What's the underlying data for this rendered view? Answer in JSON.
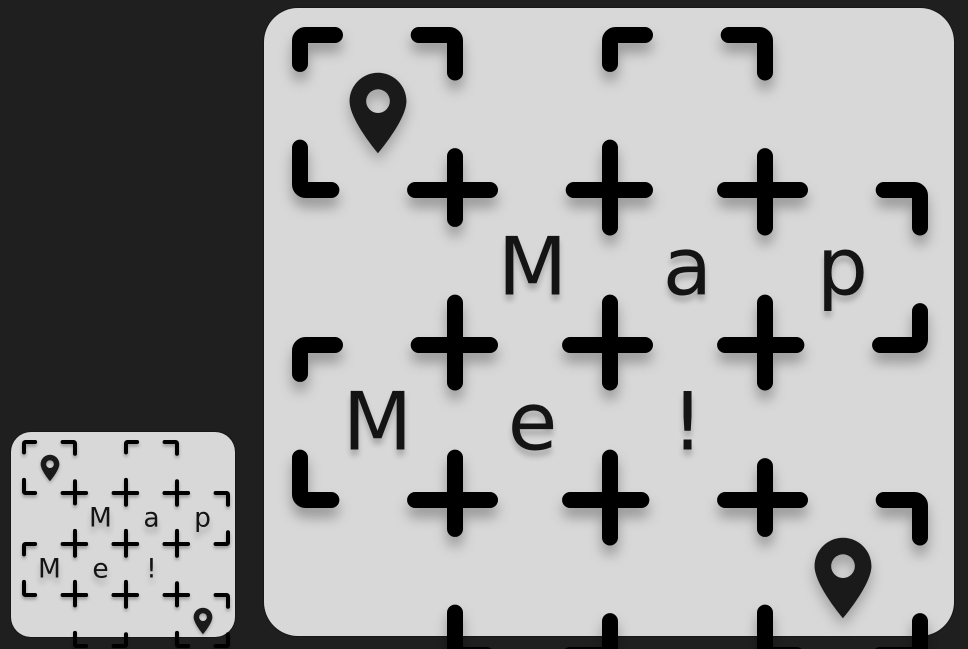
{
  "large_logo": {
    "letters": [
      {
        "text": "M",
        "row": 1,
        "col": 1
      },
      {
        "text": "a",
        "row": 1,
        "col": 2
      },
      {
        "text": "p",
        "row": 1,
        "col": 3
      },
      {
        "text": "M",
        "row": 2,
        "col": 0
      },
      {
        "text": "e",
        "row": 2,
        "col": 1
      },
      {
        "text": "!",
        "row": 2,
        "col": 2
      }
    ],
    "pins": [
      {
        "icon": "map-pin-icon",
        "row": 0,
        "col": 0
      },
      {
        "icon": "map-pin-icon",
        "row": 3,
        "col": 3
      }
    ],
    "cells": [
      [
        0,
        0
      ],
      [
        0,
        2
      ],
      [
        1,
        1
      ],
      [
        1,
        2
      ],
      [
        1,
        3
      ],
      [
        2,
        0
      ],
      [
        2,
        1
      ],
      [
        2,
        2
      ],
      [
        3,
        1
      ],
      [
        3,
        3
      ]
    ]
  },
  "small_logo": {
    "letters": [
      {
        "text": "M",
        "row": 1,
        "col": 1
      },
      {
        "text": "a",
        "row": 1,
        "col": 2
      },
      {
        "text": "p",
        "row": 1,
        "col": 3
      },
      {
        "text": "M",
        "row": 2,
        "col": 0
      },
      {
        "text": "e",
        "row": 2,
        "col": 1
      },
      {
        "text": "!",
        "row": 2,
        "col": 2
      }
    ],
    "pins": [
      {
        "icon": "map-pin-icon",
        "row": 0,
        "col": 0
      },
      {
        "icon": "map-pin-icon",
        "row": 3,
        "col": 3
      }
    ],
    "cells": [
      [
        0,
        0
      ],
      [
        0,
        2
      ],
      [
        1,
        1
      ],
      [
        1,
        2
      ],
      [
        1,
        3
      ],
      [
        2,
        0
      ],
      [
        2,
        1
      ],
      [
        2,
        2
      ],
      [
        3,
        1
      ],
      [
        3,
        3
      ]
    ]
  },
  "colors": {
    "background": "#1f1f1f",
    "card": "#d8d8d8",
    "stroke": "#000000",
    "ink": "#141414"
  }
}
